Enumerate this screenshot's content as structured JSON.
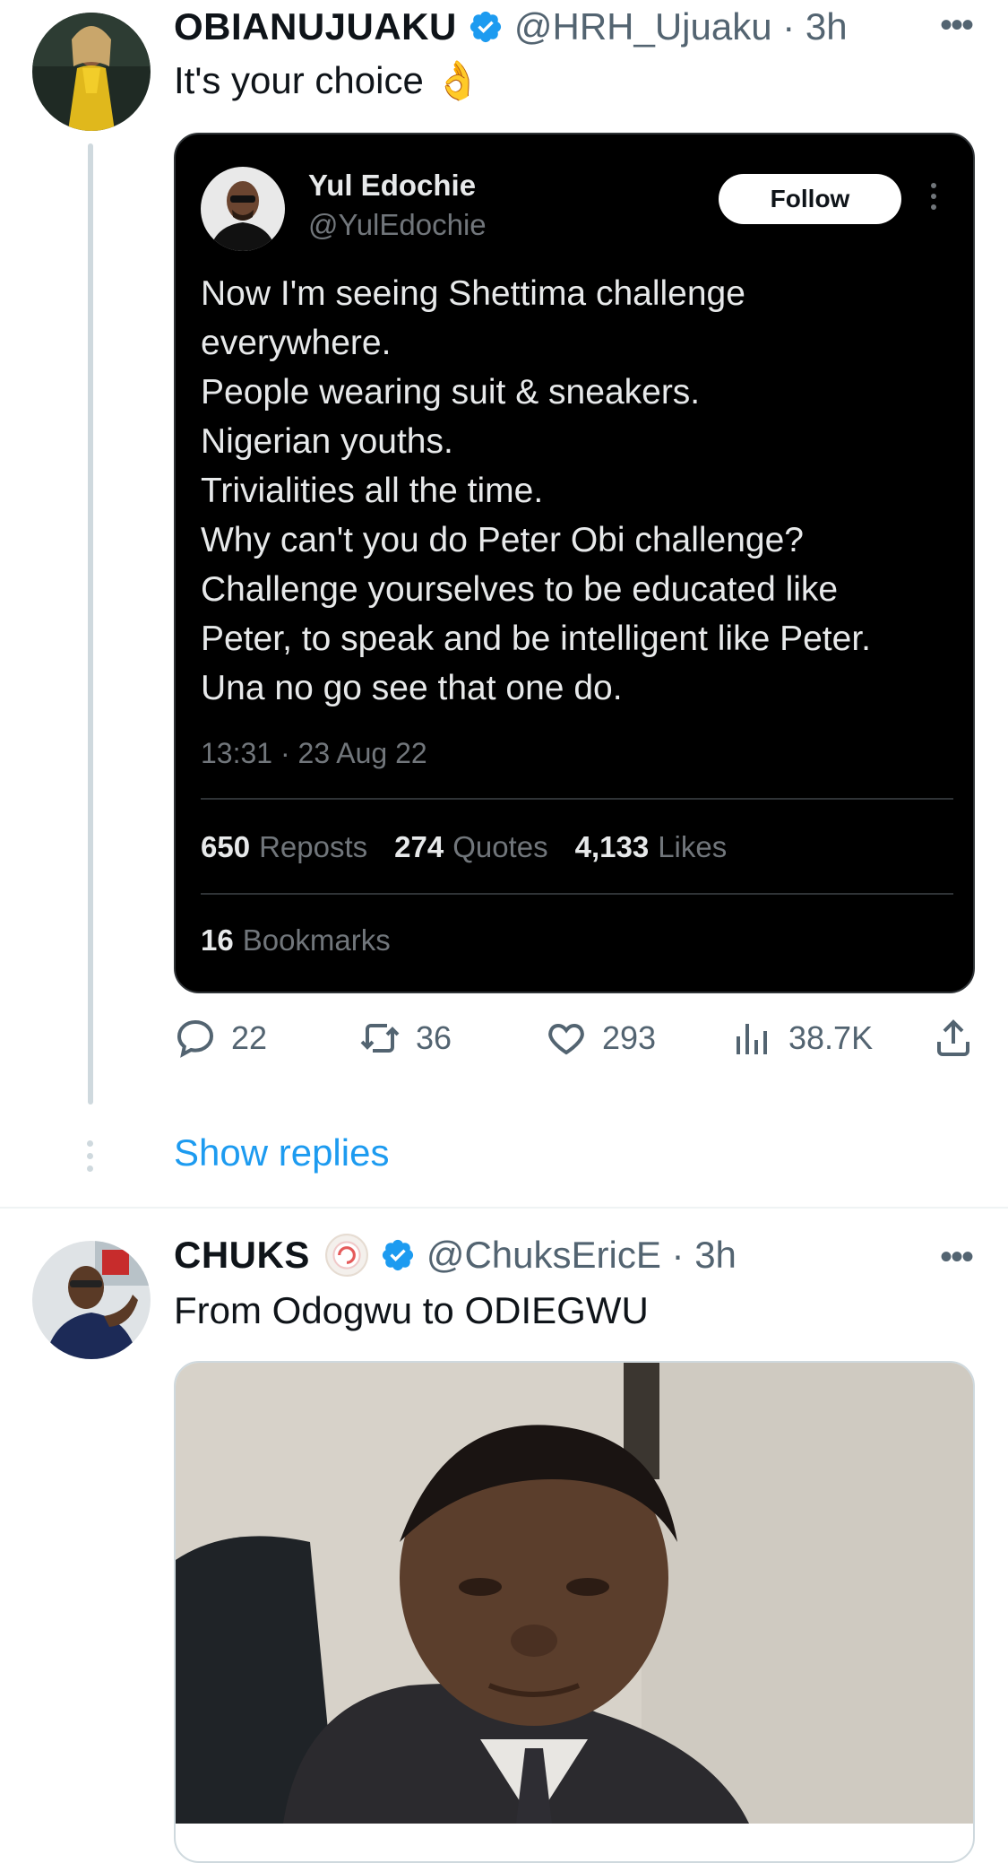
{
  "tweet1": {
    "name": "OBIANUJUAKU",
    "handle": "@HRH_Ujuaku · 3h",
    "text": "It's your choice 👌",
    "quoted": {
      "name": "Yul Edochie",
      "handle": "@YulEdochie",
      "follow_label": "Follow",
      "lines": [
        "Now I'm seeing Shettima challenge",
        "everywhere.",
        "People wearing suit & sneakers.",
        "Nigerian youths.",
        "Trivialities all the time.",
        "Why can't you do Peter Obi challenge?",
        "Challenge yourselves to be educated like",
        "Peter, to speak and be intelligent like Peter.",
        "Una no go see that one do."
      ],
      "timestamp": "13:31 · 23 Aug 22",
      "stats": {
        "reposts_value": "650",
        "reposts_label": "Reposts",
        "quotes_value": "274",
        "quotes_label": "Quotes",
        "likes_value": "4,133",
        "likes_label": "Likes",
        "bookmarks_value": "16",
        "bookmarks_label": "Bookmarks"
      }
    },
    "actions": {
      "replies": "22",
      "retweets": "36",
      "likes": "293",
      "views": "38.7K"
    },
    "show_replies_label": "Show replies"
  },
  "tweet2": {
    "name": "CHUKS",
    "handle": "@ChuksEricE · 3h",
    "text": "From Odogwu to ODIEGWU"
  },
  "colors": {
    "accent": "#1d9bf0",
    "verified": "#1d9bf0",
    "muted": "#536471",
    "card_bg": "#000000"
  },
  "icons": [
    "verified-badge-icon",
    "more-icon",
    "reply-icon",
    "retweet-icon",
    "like-icon",
    "views-icon",
    "share-icon"
  ]
}
